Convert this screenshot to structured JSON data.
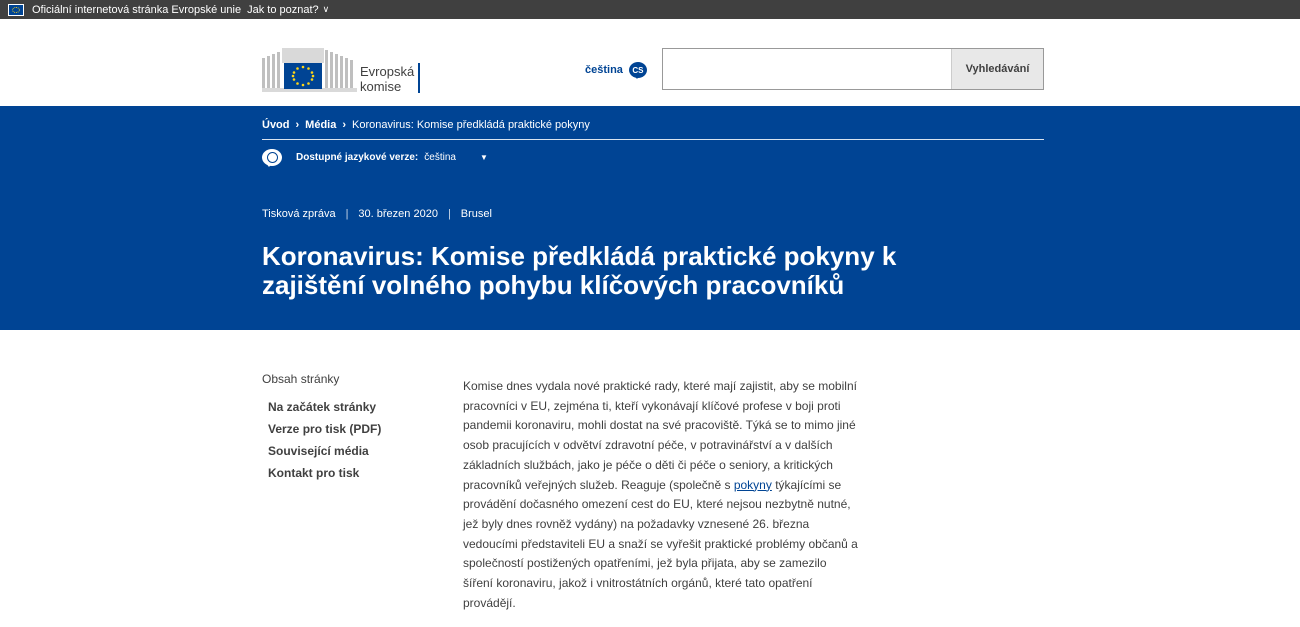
{
  "globan": {
    "official_text": "Oficiální internetová stránka Evropské unie",
    "how_to_know": "Jak to poznat?"
  },
  "header": {
    "logo_line1": "Evropská",
    "logo_line2": "komise",
    "language_label": "čeština",
    "language_code": "CS",
    "search_placeholder": "",
    "search_button": "Vyhledávání"
  },
  "breadcrumb": {
    "home": "Úvod",
    "media": "Média",
    "current": "Koronavirus: Komise předkládá praktické pokyny"
  },
  "languages": {
    "label": "Dostupné jazykové verze:",
    "value": "čeština",
    "arrow": "▼"
  },
  "meta": {
    "type": "Tisková zpráva",
    "date": "30. březen 2020",
    "place": "Brusel"
  },
  "title": "Koronavirus: Komise předkládá praktické pokyny k zajištění volného pohybu klíčových pracovníků",
  "toc": {
    "heading": "Obsah stránky",
    "items": [
      "Na začátek stránky",
      "Verze pro tisk (PDF)",
      "Související média",
      "Kontakt pro tisk"
    ]
  },
  "content": {
    "part1": "Komise dnes vydala nové praktické rady, které mají zajistit, aby se mobilní pracovníci v EU, zejména ti, kteří vykonávají klíčové profese v boji proti pandemii koronaviru, mohli dostat na své pracoviště. Týká se to mimo jiné osob pracujících v odvětví zdravotní péče, v potravinářství a v dalších základních službách, jako je péče o děti či péče o seniory, a kritických pracovníků veřejných služeb. Reaguje (společně s ",
    "link": "pokyny",
    "part2": " týkajícími se provádění dočasného omezení cest do EU, které nejsou nezbytně nutné, jež byly dnes rovněž vydány) na požadavky vznesené 26. března vedoucími představiteli EU a snaží se vyřešit praktické problémy občanů a společností postižených opatřeními, jež byla přijata, aby se zamezilo šíření koronaviru, jakož i vnitrostátních orgánů, které tato opatření provádějí."
  },
  "colors": {
    "brand_blue": "#004494",
    "dark_bar": "#404040",
    "text": "#404040",
    "eu_yellow": "#ffd617"
  }
}
